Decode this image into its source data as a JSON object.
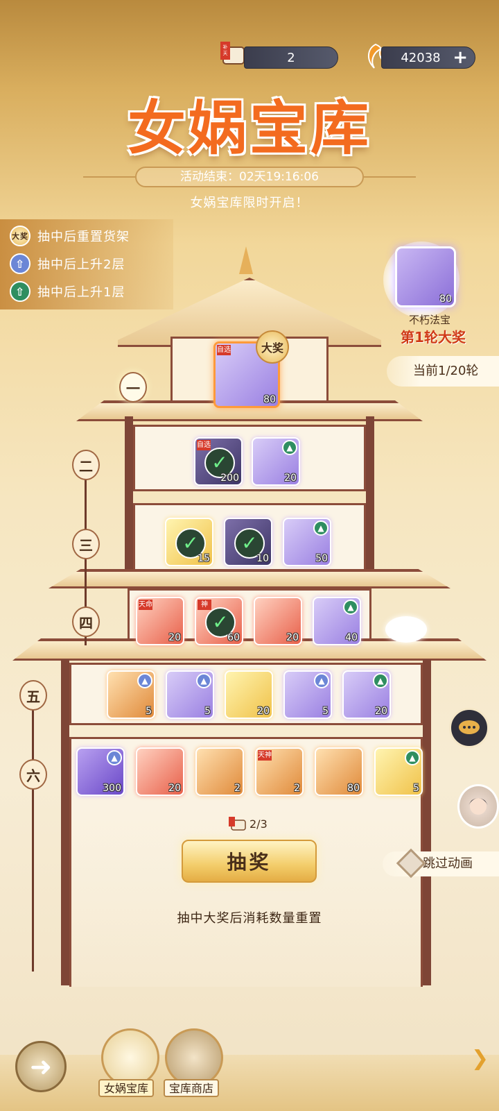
{
  "currency": {
    "ticket_label": "补天",
    "ticket_count": "2",
    "coin_amount": "42038",
    "add_symbol": "+"
  },
  "header": {
    "title": "女娲宝库",
    "countdown": "活动结束：02天19:16:06",
    "subtitle": "女娲宝库限时开启！"
  },
  "legend": [
    {
      "badge": "大奖",
      "text": "抽中后重置货架"
    },
    {
      "badge": "⇧",
      "text": "抽中后上升2层"
    },
    {
      "badge": "⇧",
      "text": "抽中后上升1层"
    }
  ],
  "grand_prize": {
    "count": "80",
    "name": "不朽法宝",
    "round_label": "第1轮大奖",
    "current_round": "当前1/20轮"
  },
  "levels": [
    "一",
    "二",
    "三",
    "四",
    "五",
    "六"
  ],
  "floors": {
    "f1": [
      {
        "count": "80",
        "tag": "自选",
        "badge": "大奖"
      }
    ],
    "f2": [
      {
        "count": "200",
        "tag": "自选",
        "claimed": true
      },
      {
        "count": "20",
        "up": "1"
      }
    ],
    "f3": [
      {
        "count": "15",
        "claimed": true
      },
      {
        "count": "10",
        "claimed": true
      },
      {
        "count": "50",
        "up": "1"
      }
    ],
    "f4": [
      {
        "count": "20",
        "tag": "天命"
      },
      {
        "count": "60",
        "tag": "神",
        "claimed": true
      },
      {
        "count": "20"
      },
      {
        "count": "40",
        "up": "1"
      }
    ],
    "f5": [
      {
        "count": "5",
        "up": "2"
      },
      {
        "count": "5",
        "up": "2"
      },
      {
        "count": "20"
      },
      {
        "count": "5",
        "up": "2"
      },
      {
        "count": "20",
        "up": "1"
      }
    ],
    "f6": [
      {
        "count": "300",
        "up": "2"
      },
      {
        "count": "20"
      },
      {
        "count": "2"
      },
      {
        "count": "2",
        "tag": "天神"
      },
      {
        "count": "80"
      },
      {
        "count": "5",
        "up": "1"
      }
    ]
  },
  "draw": {
    "cost": "2/3",
    "button": "抽奖",
    "note": "抽中大奖后消耗数量重置",
    "skip": "跳过动画"
  },
  "nav": {
    "tab1": "女娲宝库",
    "tab2": "宝库商店"
  }
}
